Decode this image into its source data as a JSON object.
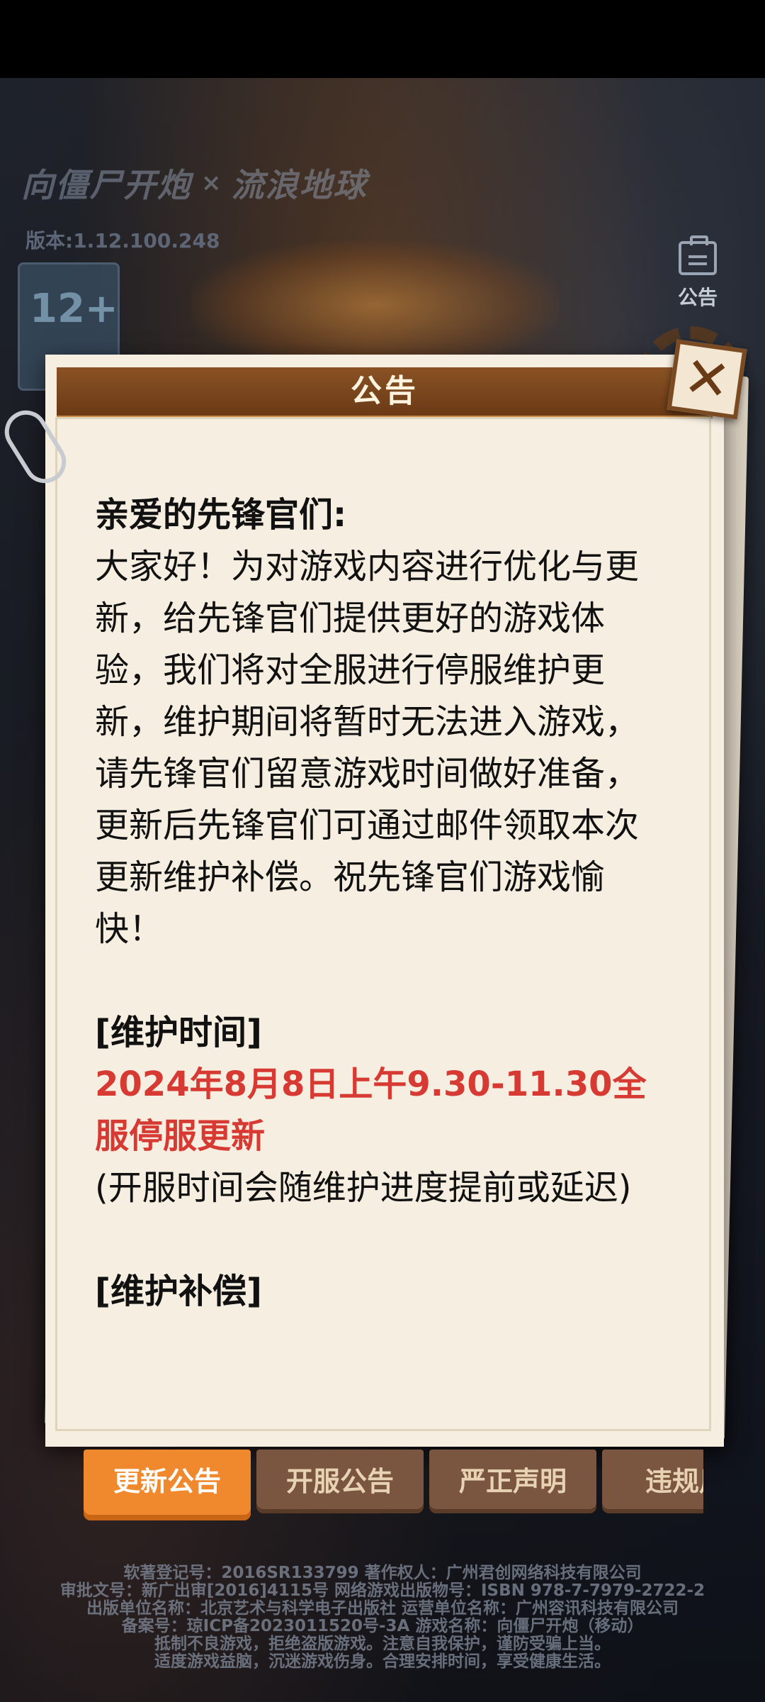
{
  "background": {
    "logo_left": "向僵尸开炮",
    "logo_sep": "×",
    "logo_right": "流浪地球",
    "version": "版本:1.12.100.248",
    "age_rating": "12+",
    "notice_label": "公告"
  },
  "dialog": {
    "title": "公告",
    "close": "✕",
    "greeting": "亲爱的先锋官们:",
    "body": "大家好！为对游戏内容进行优化与更新，给先锋官们提供更好的游戏体验，我们将对全服进行停服维护更新，维护期间将暂时无法进入游戏，请先锋官们留意游戏时间做好准备，更新后先锋官们可通过邮件领取本次更新维护补偿。祝先锋官们游戏愉快！",
    "maintenance_time_title": "[维护时间]",
    "maintenance_time": "2024年8月8日上午9.30-11.30全服停服更新",
    "maintenance_note": "(开服时间会随维护进度提前或延迟)",
    "compensation_title": "[维护补偿]"
  },
  "tabs": [
    {
      "label": "更新公告",
      "active": true
    },
    {
      "label": "开服公告",
      "active": false
    },
    {
      "label": "严正声明",
      "active": false
    },
    {
      "label": "违规用",
      "active": false
    }
  ],
  "footer": [
    "软著登记号：2016SR133799  著作权人：广州君创网络科技有限公司",
    "审批文号：新广出审[2016]4115号  网络游戏出版物号：ISBN 978-7-7979-2722-2",
    "出版单位名称：北京艺术与科学电子出版社  运营单位名称：广州容讯科技有限公司",
    "备案号：琼ICP备2023011520号-3A  游戏名称：向僵尸开炮（移动）",
    "抵制不良游戏，拒绝盗版游戏。注意自我保护，谨防受骗上当。",
    "适度游戏益脑，沉迷游戏伤身。合理安排时间，享受健康生活。"
  ],
  "colors": {
    "accent_tab": "#f0892e",
    "highlight_text": "#d63a33",
    "header_brown": "#7a4a22",
    "paper": "#f6eee0"
  }
}
